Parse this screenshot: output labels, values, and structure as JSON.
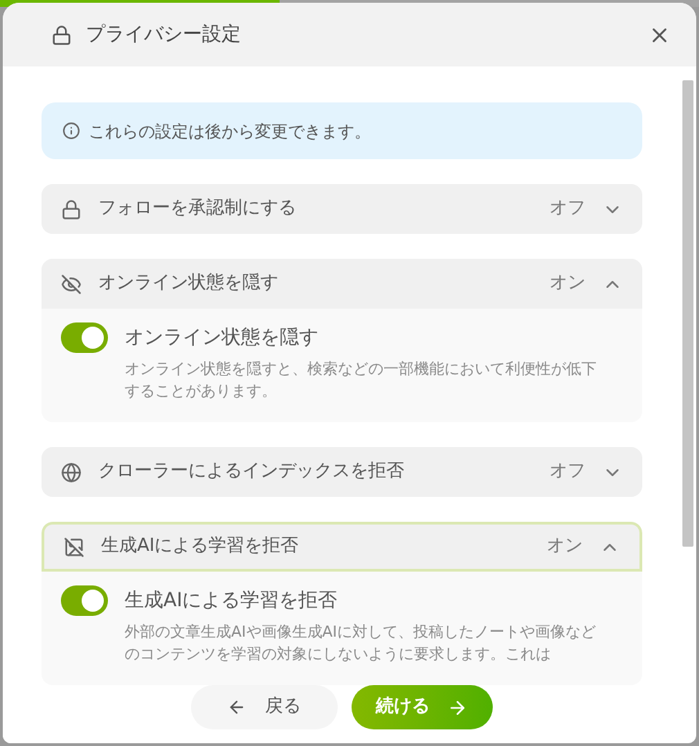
{
  "progress": {
    "level": 0.4
  },
  "dialog": {
    "title": "プライバシー設定",
    "info": "これらの設定は後から変更できます。"
  },
  "settings": [
    {
      "title": "フォローを承認制にする",
      "status": "オフ",
      "expanded": false,
      "focused": false
    },
    {
      "title": "オンライン状態を隠す",
      "status": "オン",
      "expanded": true,
      "focused": false,
      "toggle": {
        "label": "オンライン状態を隠す",
        "on": true
      },
      "description": "オンライン状態を隠すと、検索などの一部機能において利便性が低下することがあります。"
    },
    {
      "title": "クローラーによるインデックスを拒否",
      "status": "オフ",
      "expanded": false,
      "focused": false
    },
    {
      "title": "生成AIによる学習を拒否",
      "status": "オン",
      "expanded": true,
      "focused": true,
      "toggle": {
        "label": "生成AIによる学習を拒否",
        "on": true
      },
      "description": "外部の文章生成AIや画像生成AIに対して、投稿したノートや画像などのコンテンツを学習の対象にしないように要求します。これは"
    }
  ],
  "footer": {
    "back": "戻る",
    "next": "続ける"
  }
}
